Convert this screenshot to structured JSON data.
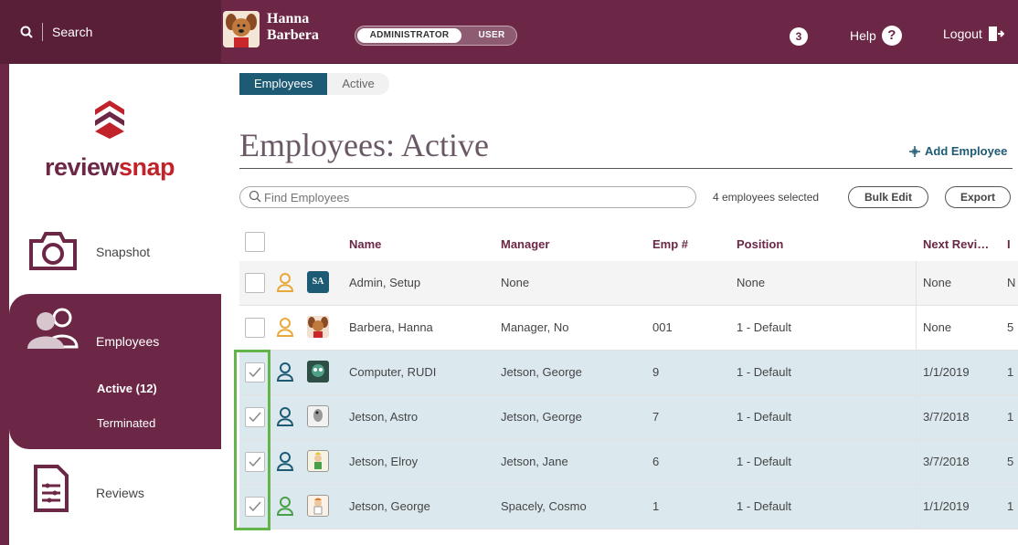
{
  "topbar": {
    "search_label": "Search",
    "user_first": "Hanna",
    "user_last": "Barbera",
    "role_admin": "ADMINISTRATOR",
    "role_user": "USER",
    "notification_count": "3",
    "help_label": "Help",
    "logout_label": "Logout"
  },
  "sidebar": {
    "logo_prefix": "review",
    "logo_suffix": "snap",
    "items": [
      {
        "label": "Snapshot",
        "icon": "camera-icon"
      },
      {
        "label": "Employees",
        "icon": "people-icon"
      },
      {
        "label": "Reviews",
        "icon": "document-icon"
      }
    ],
    "sub_active": "Active (12)",
    "sub_terminated": "Terminated"
  },
  "main": {
    "tabs": [
      "Employees",
      "Active"
    ],
    "title": "Employees: Active",
    "add_employee": "Add Employee",
    "search_placeholder": "Find Employees",
    "selected_count": "4 employees selected",
    "bulk_edit": "Bulk Edit",
    "export": "Export"
  },
  "table": {
    "columns": [
      "Name",
      "Manager",
      "Emp #",
      "Position",
      "Next Revi…",
      "I"
    ],
    "rows": [
      {
        "name": "Admin, Setup",
        "manager": "None",
        "emp": "",
        "position": "None",
        "next": "None",
        "extra": "N",
        "selected": false,
        "initials": "SA"
      },
      {
        "name": "Barbera, Hanna",
        "manager": "Manager, No",
        "emp": "001",
        "position": "1 - Default",
        "next": "None",
        "extra": "5",
        "selected": false,
        "initials": ""
      },
      {
        "name": "Computer, RUDI",
        "manager": "Jetson, George",
        "emp": "9",
        "position": "1 - Default",
        "next": "1/1/2019",
        "extra": "1",
        "selected": true,
        "initials": ""
      },
      {
        "name": "Jetson, Astro",
        "manager": "Jetson, George",
        "emp": "7",
        "position": "1 - Default",
        "next": "3/7/2018",
        "extra": "1",
        "selected": true,
        "initials": ""
      },
      {
        "name": "Jetson, Elroy",
        "manager": "Jetson, Jane",
        "emp": "6",
        "position": "1 - Default",
        "next": "3/7/2018",
        "extra": "5",
        "selected": true,
        "initials": ""
      },
      {
        "name": "Jetson, George",
        "manager": "Spacely, Cosmo",
        "emp": "1",
        "position": "1 - Default",
        "next": "1/1/2019",
        "extra": "1",
        "selected": true,
        "initials": ""
      }
    ]
  },
  "colors": {
    "brand": "#6b2745",
    "accent": "#1d5a73",
    "selected_row": "#dbe9ef",
    "highlight": "#62b44b"
  }
}
